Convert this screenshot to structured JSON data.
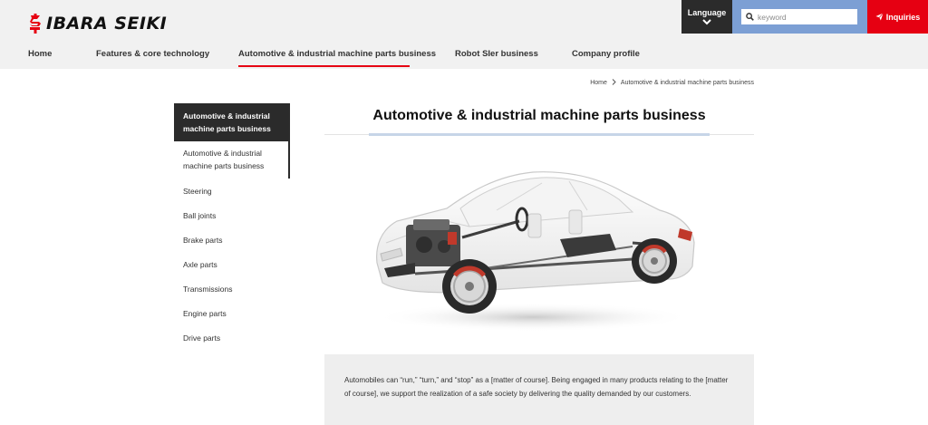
{
  "header": {
    "logo_text": "IBARA SEIKI",
    "language_label": "Language",
    "search_placeholder": "keyword",
    "inquiries_label": "Inquiries",
    "colors": {
      "accent_red": "#e60012",
      "search_blue": "#7c9fd4",
      "dark": "#2b2b2b"
    }
  },
  "nav": {
    "items": [
      {
        "label": "Home"
      },
      {
        "label": "Features & core technology"
      },
      {
        "label": "Automotive & industrial machine parts business",
        "active": true
      },
      {
        "label": "Robot SIer business"
      },
      {
        "label": "Company profile"
      }
    ]
  },
  "breadcrumb": {
    "home": "Home",
    "current": "Automotive & industrial machine parts business"
  },
  "sidebar": {
    "heading": "Automotive & industrial machine parts business",
    "sub": "Automotive & industrial machine parts business",
    "items": [
      {
        "label": "Steering"
      },
      {
        "label": "Ball joints"
      },
      {
        "label": "Brake parts"
      },
      {
        "label": "Axle parts"
      },
      {
        "label": "Transmissions"
      },
      {
        "label": "Engine parts"
      },
      {
        "label": "Drive parts"
      }
    ]
  },
  "main": {
    "title": "Automotive & industrial machine parts business",
    "image_name": "transparent-car-chassis-illustration",
    "intro": "Automobiles can “run,” “turn,” and “stop” as a [matter of course]. Being engaged in many products relating to the [matter of course], we support the realization of a safe society by delivering the quality demanded by our customers."
  }
}
